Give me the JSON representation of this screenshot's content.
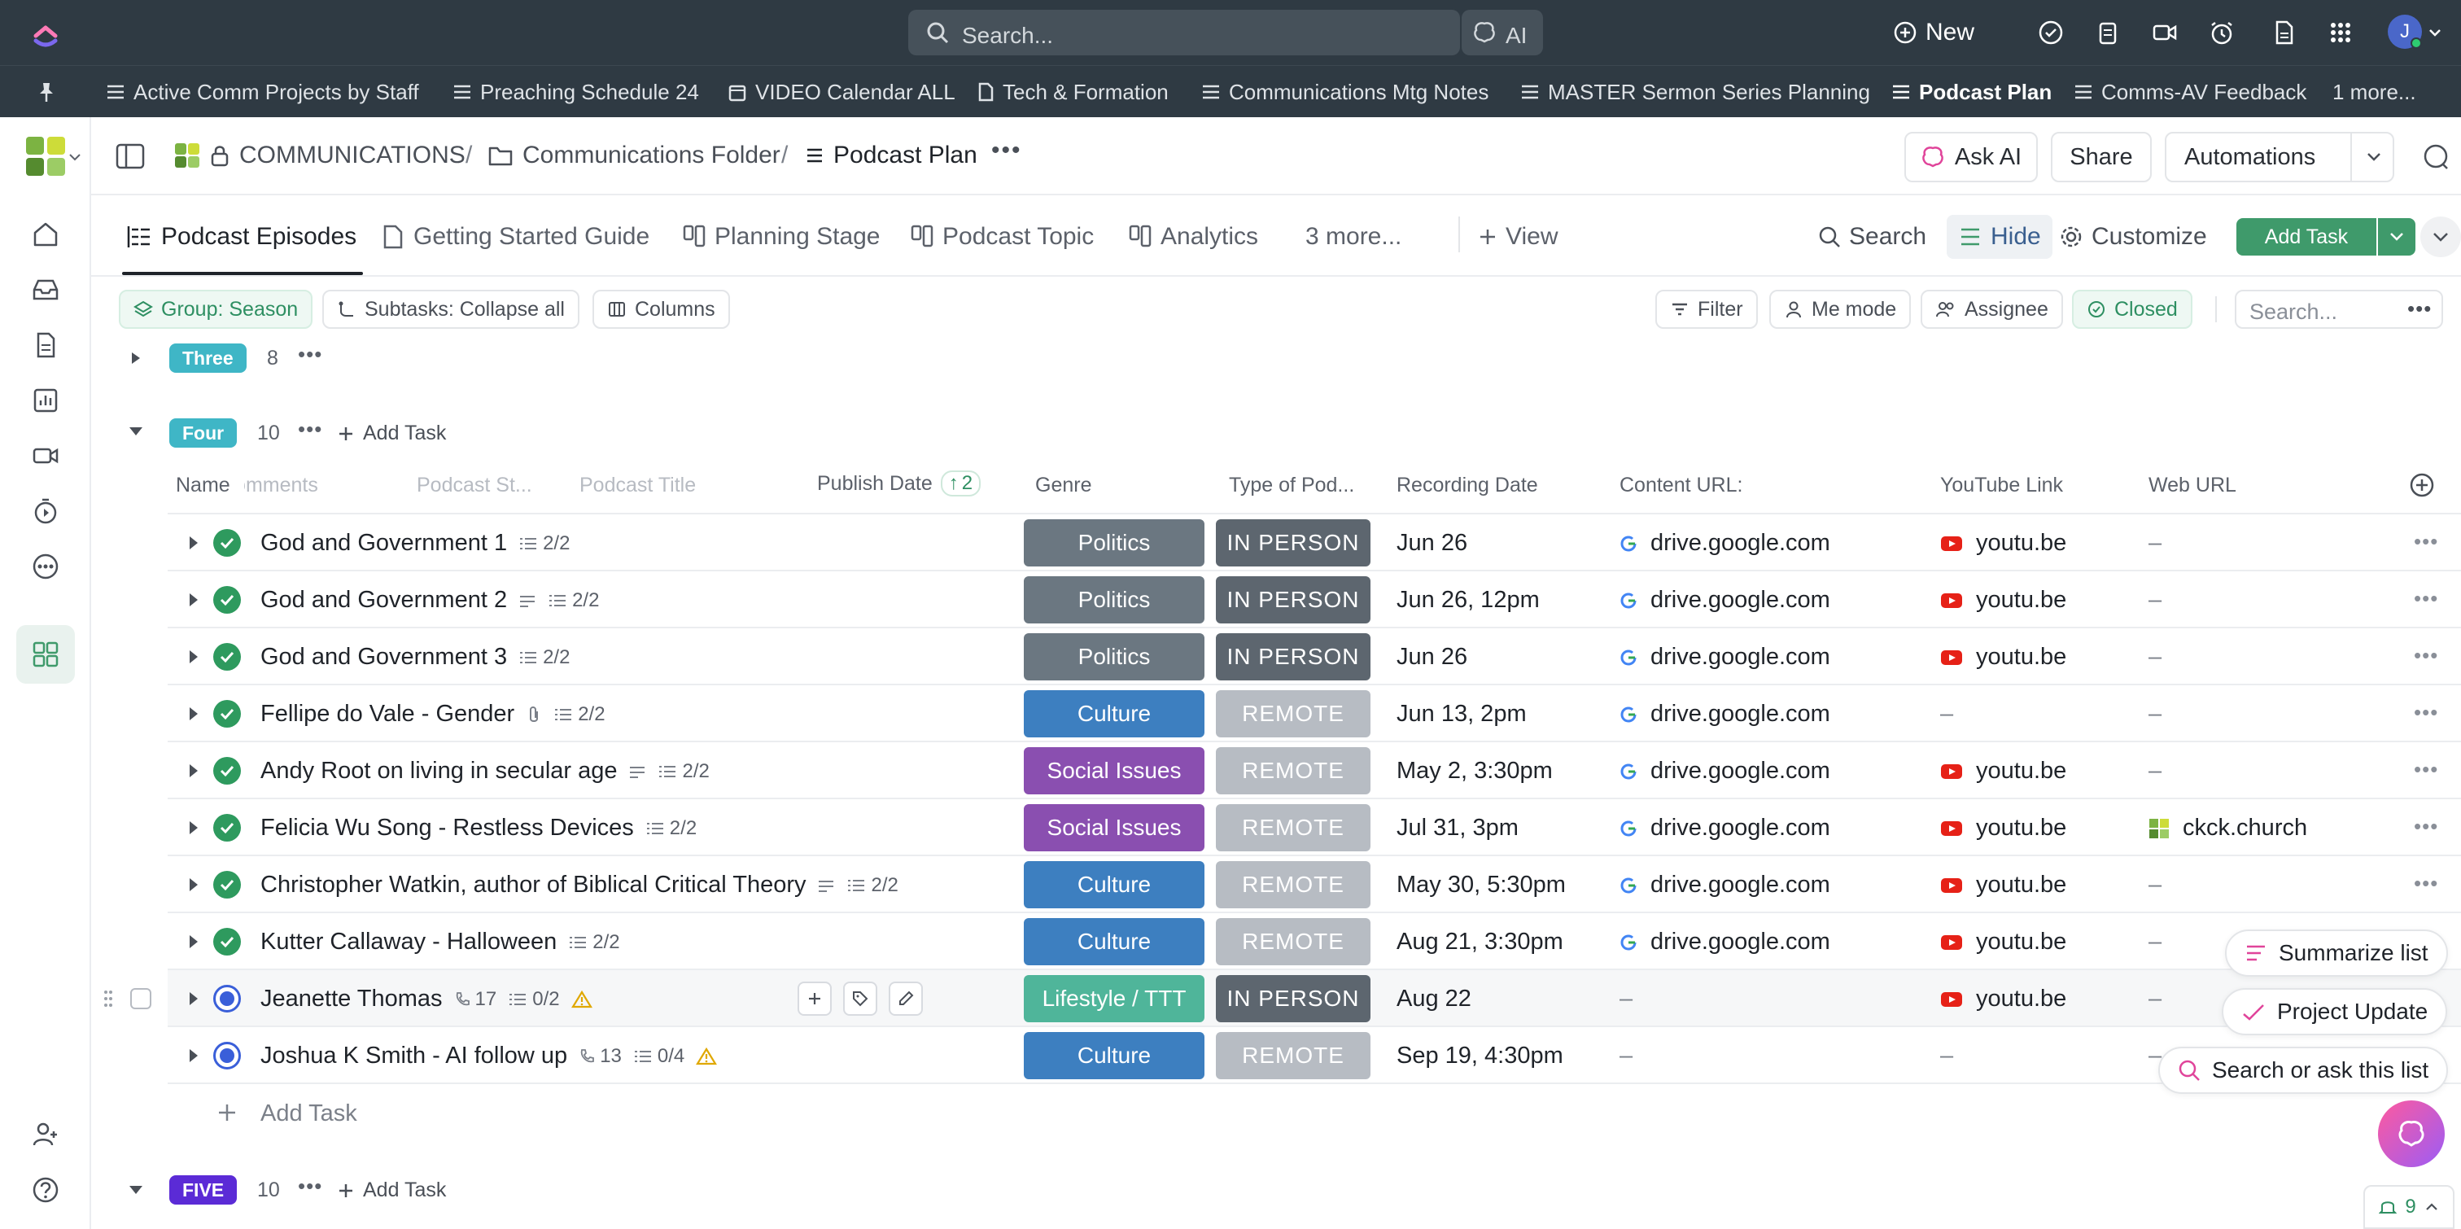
{
  "topbar": {
    "search_placeholder": "Search...",
    "ai_label": "AI",
    "new_label": "New",
    "avatar_initial": "J"
  },
  "favorites": [
    {
      "label": "Active Comm Projects by Staff",
      "icon": "list-icon"
    },
    {
      "label": "Preaching Schedule 24",
      "icon": "list-icon"
    },
    {
      "label": "VIDEO Calendar ALL",
      "icon": "calendar-icon"
    },
    {
      "label": "Tech & Formation",
      "icon": "doc-icon"
    },
    {
      "label": "Communications Mtg Notes",
      "icon": "list-icon"
    },
    {
      "label": "MASTER Sermon Series Planning",
      "icon": "list-icon"
    },
    {
      "label": "Podcast Plan",
      "icon": "list-icon",
      "active": true
    },
    {
      "label": "Comms-AV Feedback",
      "icon": "list-icon"
    },
    {
      "label": "1 more..."
    }
  ],
  "breadcrumb": {
    "space": "COMMUNICATIONS",
    "folder": "Communications Folder",
    "list": "Podcast Plan"
  },
  "header_actions": {
    "ask_ai": "Ask AI",
    "share": "Share",
    "automations": "Automations"
  },
  "views": {
    "tabs": [
      "Podcast Episodes",
      "Getting Started Guide",
      "Planning Stage",
      "Podcast Topic",
      "Analytics"
    ],
    "more": "3 more...",
    "add_view": "View",
    "search": "Search",
    "hide": "Hide",
    "customize": "Customize",
    "add_task": "Add Task"
  },
  "filters": {
    "group": "Group: Season",
    "subtasks": "Subtasks: Collapse all",
    "columns": "Columns",
    "filter": "Filter",
    "me_mode": "Me mode",
    "assignee": "Assignee",
    "closed": "Closed",
    "search_placeholder": "Search..."
  },
  "groups": {
    "three": {
      "label": "Three",
      "count": "8",
      "color": "#3fb6c6"
    },
    "four": {
      "label": "Four",
      "count": "10",
      "color": "#3fb6c6",
      "add_task": "Add Task"
    },
    "five": {
      "label": "FIVE",
      "count": "10",
      "color": "#5b2bd6",
      "add_task": "Add Task"
    }
  },
  "columns": {
    "name": "Name",
    "comments": "Comments",
    "podcast_status": "Podcast St...",
    "podcast_title": "Podcast Title",
    "publish_date": "Publish Date",
    "publish_sort_count": "2",
    "genre": "Genre",
    "type": "Type of Pod...",
    "recording_date": "Recording Date",
    "content_url": "Content URL:",
    "youtube": "YouTube Link",
    "web_url": "Web URL"
  },
  "genre_colors": {
    "Politics": "#6b7781",
    "Culture": "#3d7fc0",
    "Social Issues": "#8a4fb0",
    "Lifestyle / TTT": "#4fb59a"
  },
  "type_colors": {
    "IN PERSON": "#5d666f",
    "REMOTE": "#b7bcc3"
  },
  "tasks": [
    {
      "name": "God and Government 1",
      "subtasks": "2/2",
      "genre": "Politics",
      "type": "IN PERSON",
      "recording": "Jun 26",
      "content": "drive.google.com",
      "youtube": "youtu.be",
      "web": "–",
      "status": "done"
    },
    {
      "name": "God and Government 2",
      "subtasks": "2/2",
      "genre": "Politics",
      "type": "IN PERSON",
      "recording": "Jun 26, 12pm",
      "content": "drive.google.com",
      "youtube": "youtu.be",
      "web": "–",
      "status": "done"
    },
    {
      "name": "God and Government 3",
      "subtasks": "2/2",
      "genre": "Politics",
      "type": "IN PERSON",
      "recording": "Jun 26",
      "content": "drive.google.com",
      "youtube": "youtu.be",
      "web": "–",
      "status": "done"
    },
    {
      "name": "Fellipe do Vale - Gender",
      "subtasks": "2/2",
      "genre": "Culture",
      "type": "REMOTE",
      "recording": "Jun 13, 2pm",
      "content": "drive.google.com",
      "youtube": "–",
      "web": "–",
      "status": "done"
    },
    {
      "name": "Andy Root on living in secular age",
      "subtasks": "2/2",
      "genre": "Social Issues",
      "type": "REMOTE",
      "recording": "May 2, 3:30pm",
      "content": "drive.google.com",
      "youtube": "youtu.be",
      "web": "–",
      "status": "done"
    },
    {
      "name": "Felicia Wu Song - Restless Devices",
      "subtasks": "2/2",
      "genre": "Social Issues",
      "type": "REMOTE",
      "recording": "Jul 31, 3pm",
      "content": "drive.google.com",
      "youtube": "youtu.be",
      "web": "ckck.church",
      "status": "done"
    },
    {
      "name": "Christopher Watkin, author of Biblical Critical Theory",
      "subtasks": "2/2",
      "genre": "Culture",
      "type": "REMOTE",
      "recording": "May 30, 5:30pm",
      "content": "drive.google.com",
      "youtube": "youtu.be",
      "web": "–",
      "status": "done"
    },
    {
      "name": "Kutter Callaway - Halloween",
      "subtasks": "2/2",
      "genre": "Culture",
      "type": "REMOTE",
      "recording": "Aug 21, 3:30pm",
      "content": "drive.google.com",
      "youtube": "youtu.be",
      "web": "–",
      "status": "done"
    },
    {
      "name": "Jeanette Thomas",
      "links": "17",
      "subtasks": "0/2",
      "genre": "Lifestyle / TTT",
      "type": "IN PERSON",
      "recording": "Aug 22",
      "content": "–",
      "youtube": "youtu.be",
      "web": "–",
      "status": "todo"
    },
    {
      "name": "Joshua K Smith - AI follow up",
      "links": "13",
      "subtasks": "0/4",
      "genre": "Culture",
      "type": "REMOTE",
      "recording": "Sep 19, 4:30pm",
      "content": "–",
      "youtube": "–",
      "web": "–",
      "status": "todo"
    }
  ],
  "add_task_row": "Add Task",
  "ai_float": {
    "summarize": "Summarize list",
    "project_update": "Project Update",
    "search_ask": "Search or ask this list"
  },
  "bottom_counter": "9"
}
